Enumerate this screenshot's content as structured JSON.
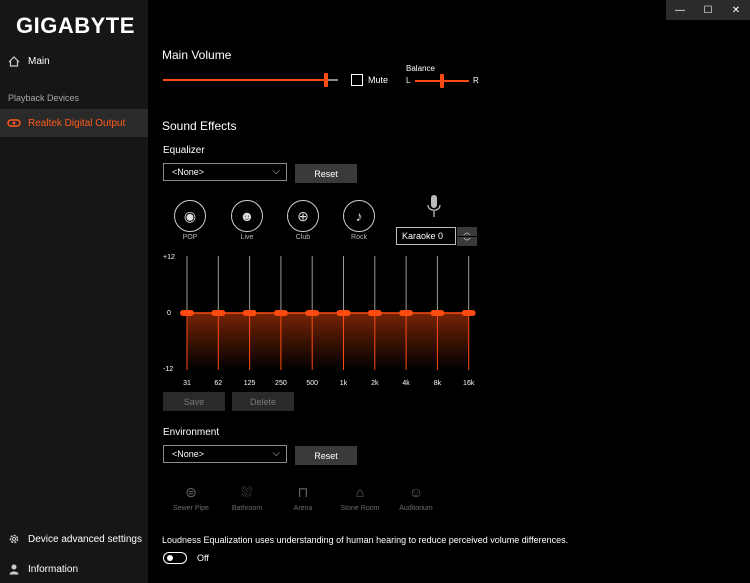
{
  "app": {
    "brand": "GIGABYTE"
  },
  "window_controls": {
    "minimize": "—",
    "maximize": "☐",
    "close": "✕"
  },
  "sidebar": {
    "main_label": "Main",
    "section_label": "Playback Devices",
    "device_label": "Realtek Digital Output",
    "advanced_label": "Device advanced settings",
    "info_label": "Information"
  },
  "main_volume": {
    "title": "Main Volume",
    "level_fraction": 0.98,
    "mute_label": "Mute",
    "mute_checked": false,
    "balance_label": "Balance",
    "balance_left": "L",
    "balance_right": "R",
    "balance_fraction": 0.5
  },
  "sound_effects": {
    "title": "Sound Effects",
    "equalizer_label": "Equalizer",
    "equalizer_select": "<None>",
    "reset_label": "Reset",
    "presets": [
      "POP",
      "Live",
      "Club",
      "Rock"
    ],
    "karaoke_value": "Karaoke 0",
    "eq": {
      "max_label": "+12",
      "zero_label": "0",
      "min_label": "-12",
      "bands": [
        "31",
        "62",
        "125",
        "250",
        "500",
        "1k",
        "2k",
        "4k",
        "8k",
        "16k"
      ],
      "values": [
        0,
        0,
        0,
        0,
        0,
        0,
        0,
        0,
        0,
        0
      ],
      "range": [
        -12,
        12
      ]
    },
    "save_label": "Save",
    "delete_label": "Delete"
  },
  "environment": {
    "title": "Environment",
    "select": "<None>",
    "reset_label": "Reset",
    "items": [
      "Sewer Pipe",
      "Bathroom",
      "Arena",
      "Stone Room",
      "Auditorium"
    ]
  },
  "loudness": {
    "description": "Loudness Equalization uses understanding of human hearing to reduce perceived volume differences.",
    "state_label": "Off"
  },
  "colors": {
    "accent": "#ff4a10",
    "sidebar_bg": "#161616",
    "button_bg": "#3a3a3a"
  }
}
